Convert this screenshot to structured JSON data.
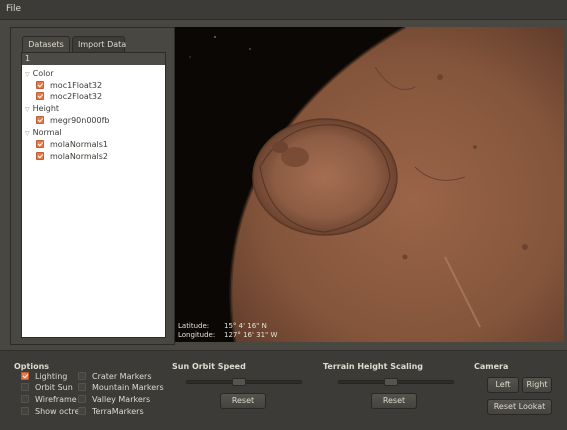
{
  "menubar": {
    "file_label": "File"
  },
  "sidebar": {
    "tabs": [
      {
        "label": "Datasets",
        "active": true
      },
      {
        "label": "Import Data",
        "active": false
      }
    ],
    "tree_header": "1",
    "groups": [
      {
        "label": "Color",
        "items": [
          "moc1Float32",
          "moc2Float32"
        ]
      },
      {
        "label": "Height",
        "items": [
          "megr90n000fb"
        ]
      },
      {
        "label": "Normal",
        "items": [
          "molaNormals1",
          "molaNormals2"
        ]
      }
    ]
  },
  "viewport": {
    "latitude_label": "Latitude:",
    "latitude_value": "15° 4' 16\" N",
    "longitude_label": "Longitude:",
    "longitude_value": "127° 16' 31\" W"
  },
  "options": {
    "title": "Options",
    "col1": [
      {
        "label": "Lighting",
        "checked": true
      },
      {
        "label": "Orbit Sun",
        "checked": false
      },
      {
        "label": "Wireframe",
        "checked": false
      },
      {
        "label": "Show octree",
        "checked": false
      }
    ],
    "col2": [
      {
        "label": "Crater Markers",
        "checked": false
      },
      {
        "label": "Mountain Markers",
        "checked": false
      },
      {
        "label": "Valley Markers",
        "checked": false
      },
      {
        "label": "TerraMarkers",
        "checked": false
      }
    ]
  },
  "sun_orbit": {
    "title": "Sun Orbit Speed",
    "slider_value": 0.45,
    "reset_label": "Reset"
  },
  "terrain": {
    "title": "Terrain Height Scaling",
    "slider_value": 0.45,
    "reset_label": "Reset"
  },
  "camera": {
    "title": "Camera",
    "left_label": "Left",
    "right_label": "Right",
    "reset_lookat_label": "Reset Lookat"
  },
  "colors": {
    "accent": "#e47a4a",
    "window_bg": "#3c3b37",
    "mars": "#8a5a40"
  }
}
